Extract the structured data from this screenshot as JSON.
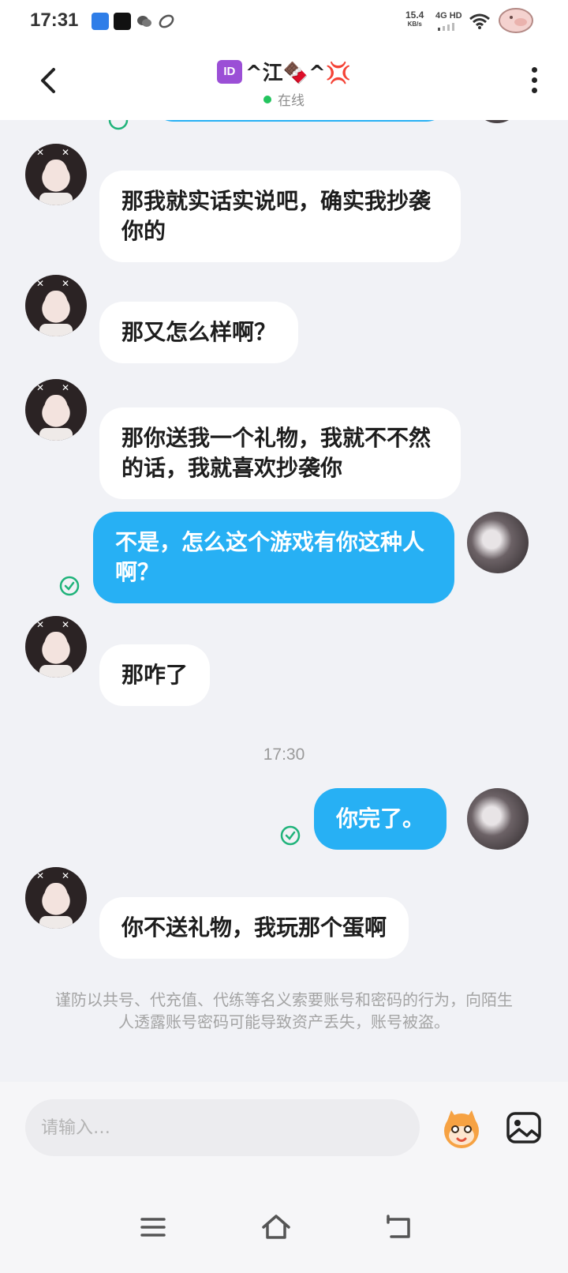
{
  "status_bar": {
    "time": "17:31",
    "speed_value": "15.4",
    "speed_unit": "KB/s",
    "network": "4G HD"
  },
  "header": {
    "title_badge": "ID",
    "title_text": "^江🍫^💢",
    "status": "在线"
  },
  "messages": [
    {
      "from": "other",
      "text": "那我就实话实说吧，确实我抄袭你的"
    },
    {
      "from": "other",
      "text": "那又怎么样啊？"
    },
    {
      "from": "other",
      "text": "那你送我一个礼物，我就不不然的话，我就喜欢抄袭你"
    },
    {
      "from": "me",
      "text": "不是，怎么这个游戏有你这种人啊？",
      "read": true
    },
    {
      "from": "other",
      "text": "那咋了"
    },
    {
      "from": "me",
      "text": "你完了。",
      "read": true
    },
    {
      "from": "other",
      "text": "你不送礼物，我玩那个蛋啊"
    }
  ],
  "timestamp": "17:30",
  "notice": "谨防以共号、代充值、代练等名义索要账号和密码的行为，向陌生人透露账号密码可能导致资产丢失，账号被盗。",
  "input": {
    "placeholder": "请输入…",
    "value": ""
  },
  "colors": {
    "outgoing_bubble": "#27b0f4",
    "incoming_bubble": "#ffffff",
    "online_dot": "#23c45e",
    "read_check": "#1fb37a"
  }
}
